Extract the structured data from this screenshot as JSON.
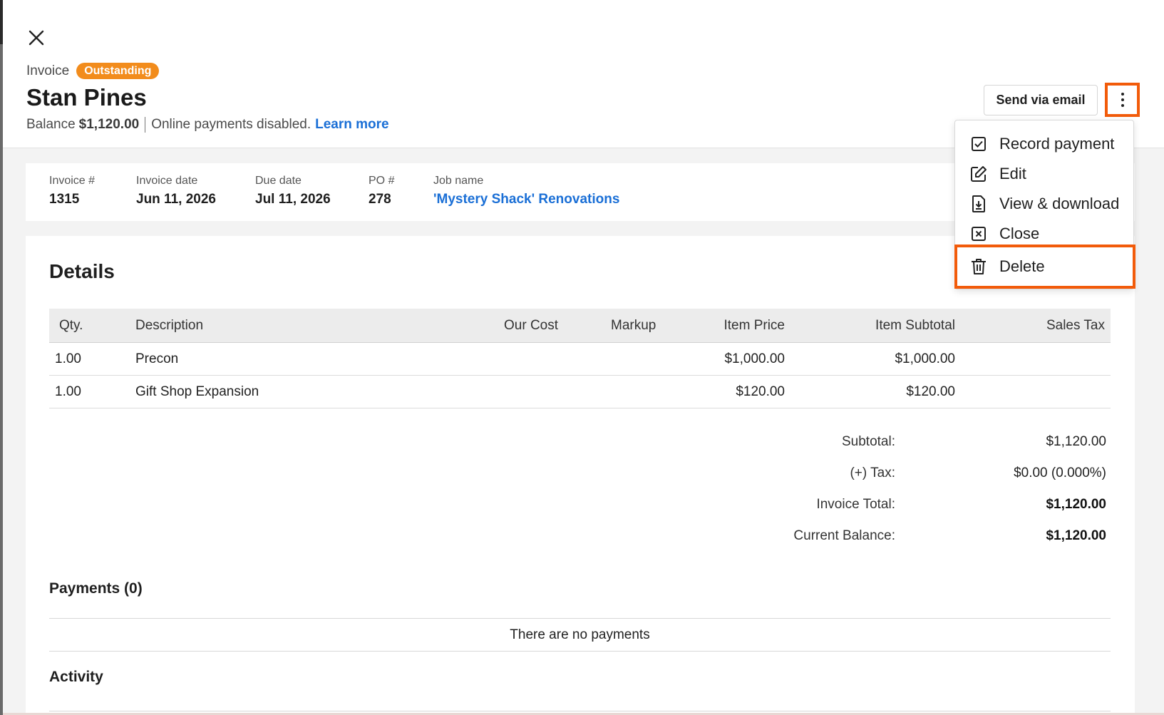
{
  "header": {
    "doc_type": "Invoice",
    "status": "Outstanding",
    "customer_name": "Stan Pines",
    "balance_label": "Balance",
    "balance_value": "$1,120.00",
    "payments_note": "Online payments disabled.",
    "learn_more": "Learn more",
    "send_button": "Send via email"
  },
  "menu": {
    "items": [
      {
        "label": "Record payment",
        "icon": "checkbox-icon"
      },
      {
        "label": "Edit",
        "icon": "pencil-icon"
      },
      {
        "label": "View & download",
        "icon": "file-download-icon"
      },
      {
        "label": "Close",
        "icon": "x-square-icon"
      },
      {
        "label": "Delete",
        "icon": "trash-icon"
      }
    ]
  },
  "info": {
    "invoice_no_label": "Invoice #",
    "invoice_no": "1315",
    "invoice_date_label": "Invoice date",
    "invoice_date": "Jun 11, 2026",
    "due_date_label": "Due date",
    "due_date": "Jul 11, 2026",
    "po_label": "PO #",
    "po": "278",
    "job_label": "Job name",
    "job": "'Mystery Shack' Renovations"
  },
  "details": {
    "title": "Details",
    "columns": [
      "Qty.",
      "Description",
      "Our Cost",
      "Markup",
      "Item Price",
      "Item Subtotal",
      "Sales Tax"
    ],
    "rows": [
      {
        "qty": "1.00",
        "description": "Precon",
        "our_cost": "",
        "markup": "",
        "item_price": "$1,000.00",
        "item_subtotal": "$1,000.00",
        "sales_tax": ""
      },
      {
        "qty": "1.00",
        "description": "Gift Shop Expansion",
        "our_cost": "",
        "markup": "",
        "item_price": "$120.00",
        "item_subtotal": "$120.00",
        "sales_tax": ""
      }
    ]
  },
  "totals": {
    "subtotal_label": "Subtotal:",
    "subtotal": "$1,120.00",
    "tax_label": "(+) Tax:",
    "tax": "$0.00 (0.000%)",
    "invoice_total_label": "Invoice Total:",
    "invoice_total": "$1,120.00",
    "current_balance_label": "Current Balance:",
    "current_balance": "$1,120.00"
  },
  "payments": {
    "title": "Payments (0)",
    "empty": "There are no payments"
  },
  "activity": {
    "title": "Activity"
  }
}
